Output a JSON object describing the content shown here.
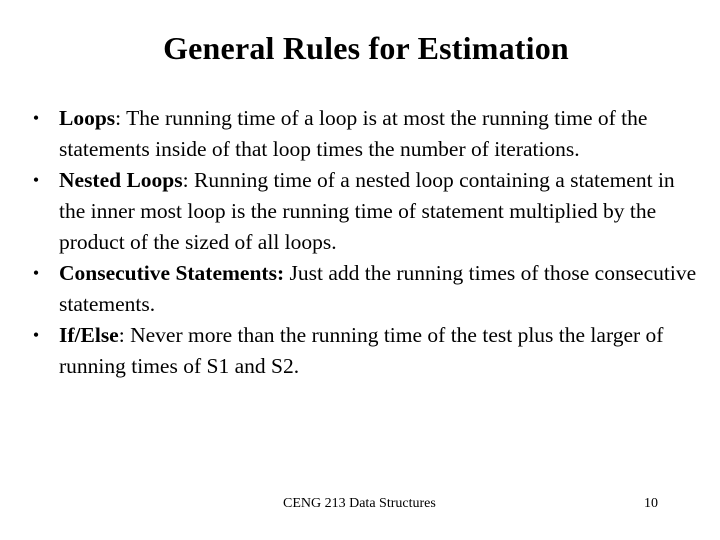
{
  "slide": {
    "title": "General Rules for Estimation",
    "bullets": [
      {
        "term": "Loops",
        "separator": ":",
        "text": " The running time of a loop is at most the running time of the statements inside of that loop times the number of iterations."
      },
      {
        "term": " Nested Loops",
        "separator": ":",
        "text": " Running time of a nested loop containing a statement in the inner most loop is the running time of statement multiplied by the product of the sized of all loops."
      },
      {
        "term": "Consecutive Statements:",
        "separator": "",
        "text": " Just add the running times of those consecutive statements."
      },
      {
        "term": "If/Else",
        "separator": ":",
        "text": " Never more than the running time of the test plus the larger of running times of S1 and S2."
      }
    ],
    "bullet_glyph": "•",
    "footer": {
      "course": "CENG 213 Data Structures",
      "page_number": "10"
    }
  }
}
